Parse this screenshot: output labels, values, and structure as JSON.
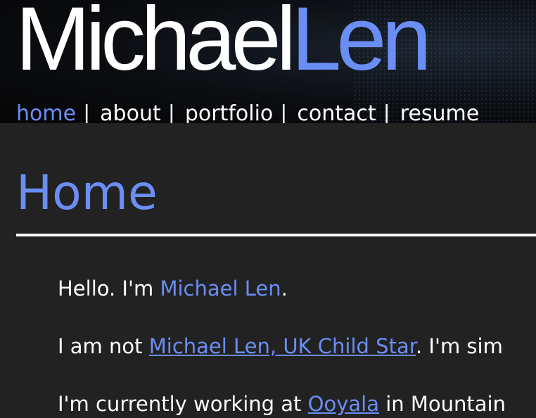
{
  "logo": {
    "first": "Michael",
    "last": "Len"
  },
  "nav": {
    "items": [
      {
        "label": "home"
      },
      {
        "label": "about"
      },
      {
        "label": "portfolio"
      },
      {
        "label": "contact"
      },
      {
        "label": "resume"
      }
    ],
    "separator": "|"
  },
  "main": {
    "title": "Home",
    "p1": {
      "prefix": "Hello. I'm ",
      "name": "Michael Len",
      "suffix": "."
    },
    "p2": {
      "prefix": "I am not ",
      "link": "Michael Len, UK Child Star",
      "suffix": ". I'm sim"
    },
    "p3": {
      "prefix": "I'm currently working at ",
      "link": "Ooyala",
      "suffix": " in Mountain"
    }
  },
  "colors": {
    "accent": "#6b8ef5",
    "background": "#222222",
    "text": "#ffffff"
  }
}
